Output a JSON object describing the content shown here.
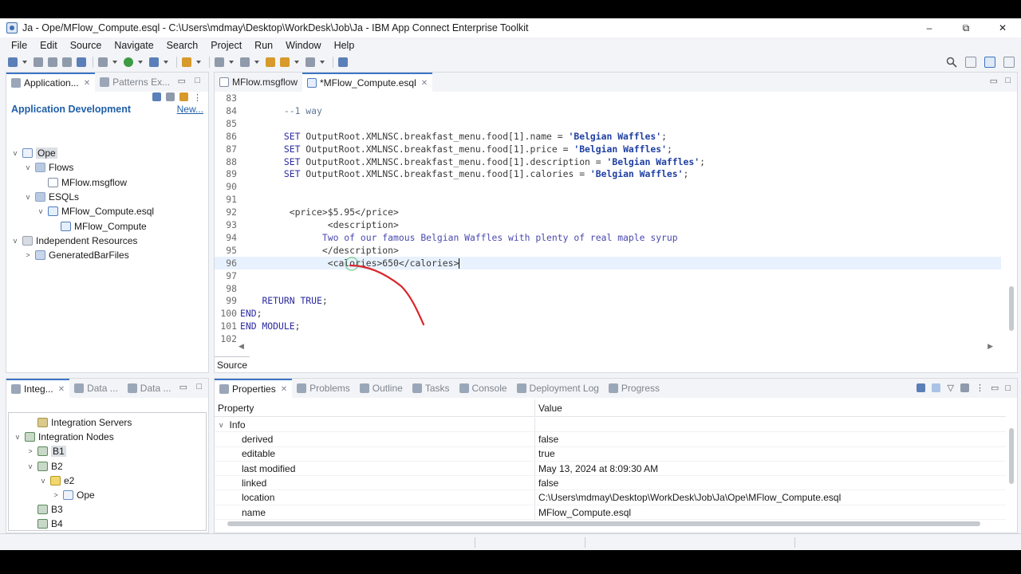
{
  "window": {
    "title": "Ja - Ope/MFlow_Compute.esql - C:\\Users\\mdmay\\Desktop\\WorkDesk\\Job\\Ja - IBM App Connect Enterprise Toolkit",
    "minimize": "–",
    "maximize": "⧉",
    "close": "✕"
  },
  "menu": [
    "File",
    "Edit",
    "Source",
    "Navigate",
    "Search",
    "Project",
    "Run",
    "Window",
    "Help"
  ],
  "left_top": {
    "tabs": [
      "Application...",
      "Patterns Ex..."
    ],
    "heading": "Application Development",
    "new_link": "New...",
    "tree": [
      {
        "label": "Ope",
        "chev": "v",
        "icon": "app",
        "indent": 0,
        "selected": true
      },
      {
        "label": "Flows",
        "chev": "v",
        "icon": "folder",
        "indent": 1
      },
      {
        "label": "MFlow.msgflow",
        "chev": "",
        "icon": "flow",
        "indent": 2
      },
      {
        "label": "ESQLs",
        "chev": "v",
        "icon": "folder",
        "indent": 1
      },
      {
        "label": "MFlow_Compute.esql",
        "chev": "v",
        "icon": "esql",
        "indent": 2
      },
      {
        "label": "MFlow_Compute",
        "chev": "",
        "icon": "esql",
        "indent": 3
      },
      {
        "label": "Independent Resources",
        "chev": "v",
        "icon": "res",
        "indent": 0
      },
      {
        "label": "GeneratedBarFiles",
        "chev": ">",
        "icon": "bar",
        "indent": 1
      }
    ]
  },
  "editor": {
    "tabs": [
      "MFlow.msgflow",
      "*MFlow_Compute.esql"
    ],
    "source_tab": "Source",
    "lines": [
      {
        "n": "83",
        "html": ""
      },
      {
        "n": "84",
        "html": "        <span class=\"cmt\">--1 way</span>"
      },
      {
        "n": "85",
        "html": ""
      },
      {
        "n": "86",
        "html": "        <span class=\"kw\">SET</span> OutputRoot.XMLNSC.breakfast_menu.food[1].name = <span class=\"str\">'Belgian Waffles'</span>;"
      },
      {
        "n": "87",
        "html": "        <span class=\"kw\">SET</span> OutputRoot.XMLNSC.breakfast_menu.food[1].price = <span class=\"str\">'Belgian Waffles'</span>;"
      },
      {
        "n": "88",
        "html": "        <span class=\"kw\">SET</span> OutputRoot.XMLNSC.breakfast_menu.food[1].description = <span class=\"str\">'Belgian Waffles'</span>;"
      },
      {
        "n": "89",
        "html": "        <span class=\"kw\">SET</span> OutputRoot.XMLNSC.breakfast_menu.food[1].calories = <span class=\"str\">'Belgian Waffles'</span>;"
      },
      {
        "n": "90",
        "html": ""
      },
      {
        "n": "91",
        "html": ""
      },
      {
        "n": "92",
        "html": "         &lt;price&gt;$5.95&lt;/price&gt;"
      },
      {
        "n": "93",
        "html": "                &lt;description&gt;"
      },
      {
        "n": "94",
        "html": "               <span class=\"txt\">Two of our famous Belgian Waffles with plenty of real maple syrup</span>"
      },
      {
        "n": "95",
        "html": "               &lt;/description&gt;"
      },
      {
        "n": "96",
        "html": "                &lt;calories&gt;650&lt;/calories&gt;<span class=\"caret\"></span>",
        "current": true
      },
      {
        "n": "97",
        "html": ""
      },
      {
        "n": "98",
        "html": ""
      },
      {
        "n": "99",
        "html": "    <span class=\"kw\">RETURN TRUE</span>;"
      },
      {
        "n": "100",
        "html": "<span class=\"kw\">END</span>;"
      },
      {
        "n": "101",
        "html": "<span class=\"kw\">END MODULE</span>;"
      },
      {
        "n": "102",
        "html": ""
      }
    ]
  },
  "left_bottom": {
    "tabs": [
      "Integ...",
      "Data ...",
      "Data ..."
    ],
    "tree": [
      {
        "label": "Integration Servers",
        "chev": "",
        "icon": "srv",
        "indent": 1
      },
      {
        "label": "Integration Nodes",
        "chev": "v",
        "icon": "node",
        "indent": 0
      },
      {
        "label": "B1",
        "chev": ">",
        "icon": "node",
        "indent": 1,
        "selected": true
      },
      {
        "label": "B2",
        "chev": "v",
        "icon": "node",
        "indent": 1
      },
      {
        "label": "e2",
        "chev": "v",
        "icon": "egrp",
        "indent": 2
      },
      {
        "label": "Ope",
        "chev": ">",
        "icon": "app",
        "indent": 3
      },
      {
        "label": "B3",
        "chev": "",
        "icon": "node",
        "indent": 1
      },
      {
        "label": "B4",
        "chev": "",
        "icon": "node",
        "indent": 1
      }
    ]
  },
  "bottom": {
    "tabs": [
      "Properties",
      "Problems",
      "Outline",
      "Tasks",
      "Console",
      "Deployment Log",
      "Progress"
    ],
    "columns": [
      "Property",
      "Value"
    ],
    "group": "Info",
    "rows": [
      {
        "k": "derived",
        "v": "false"
      },
      {
        "k": "editable",
        "v": "true"
      },
      {
        "k": "last modified",
        "v": "May 13, 2024 at 8:09:30 AM"
      },
      {
        "k": "linked",
        "v": "false"
      },
      {
        "k": "location",
        "v": "C:\\Users\\mdmay\\Desktop\\WorkDesk\\Job\\Ja\\Ope\\MFlow_Compute.esql"
      },
      {
        "k": "name",
        "v": "MFlow_Compute.esql"
      }
    ]
  },
  "colors": {
    "accent": "#3b75c4",
    "link": "#1f5fa8",
    "keyword": "#2a2aa0",
    "annotation": "#d9262b"
  }
}
